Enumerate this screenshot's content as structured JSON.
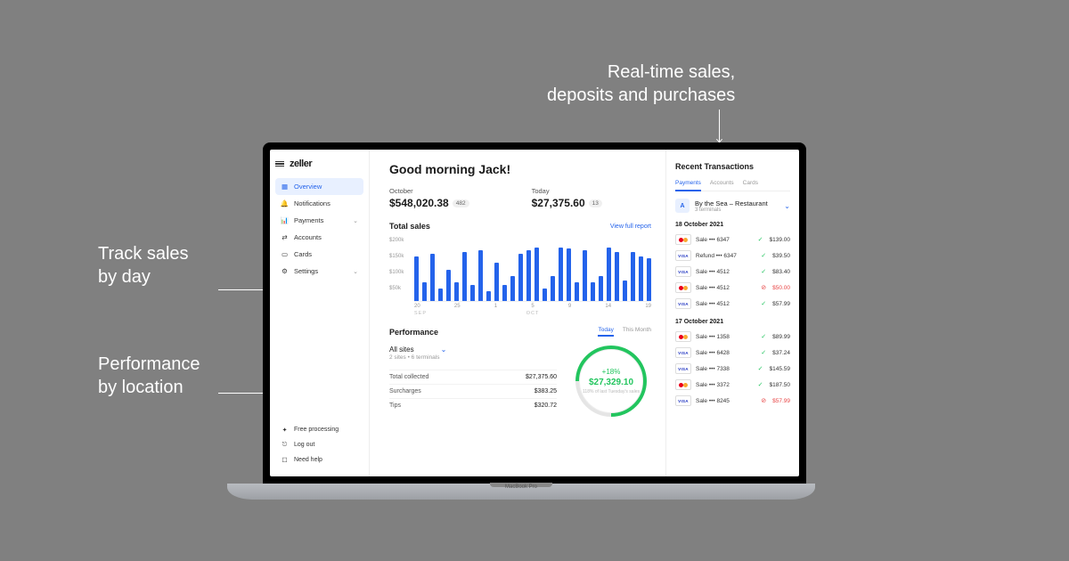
{
  "annotations": {
    "top": "Real-time sales,\ndeposits and purchases",
    "mid_line1": "Track sales",
    "mid_line2": "by day",
    "bot_line1": "Performance",
    "bot_line2": "by location"
  },
  "brand": "zeller",
  "sidebar": {
    "items": [
      {
        "label": "Overview",
        "icon": "grid",
        "active": true
      },
      {
        "label": "Notifications",
        "icon": "bell"
      },
      {
        "label": "Payments",
        "icon": "bars",
        "expandable": true
      },
      {
        "label": "Accounts",
        "icon": "swap"
      },
      {
        "label": "Cards",
        "icon": "card"
      },
      {
        "label": "Settings",
        "icon": "gear",
        "expandable": true
      }
    ],
    "footer": [
      {
        "label": "Free processing",
        "icon": "gift"
      },
      {
        "label": "Log out",
        "icon": "logout"
      },
      {
        "label": "Need help",
        "icon": "help"
      }
    ]
  },
  "main": {
    "greeting": "Good morning Jack!",
    "stats": [
      {
        "label": "October",
        "value": "$548,020.38",
        "badge": "482"
      },
      {
        "label": "Today",
        "value": "$27,375.60",
        "badge": "13"
      }
    ],
    "total_sales": {
      "title": "Total sales",
      "link": "View full report",
      "y_ticks": [
        "$200k",
        "$150k",
        "$100k",
        "$50k",
        ""
      ],
      "x_ticks": [
        "20",
        "25",
        "1",
        "5",
        "9",
        "14",
        "19"
      ],
      "x_left_label": "SEP",
      "x_mid_label": "OCT"
    },
    "performance": {
      "title": "Performance",
      "tabs": [
        "Today",
        "This Month"
      ],
      "active_tab": 0,
      "site": "All sites",
      "site_sub": "2 sites  •  6 terminals",
      "metrics": [
        {
          "label": "Total collected",
          "value": "$27,375.60"
        },
        {
          "label": "Surcharges",
          "value": "$383.25"
        },
        {
          "label": "Tips",
          "value": "$320.72"
        }
      ],
      "gauge": {
        "pct": "+18%",
        "amount": "$27,329.10",
        "sub": "118% of last Tuesday's sales"
      }
    }
  },
  "right": {
    "title": "Recent Transactions",
    "tabs": [
      "Payments",
      "Accounts",
      "Cards"
    ],
    "account": {
      "initial": "A",
      "name": "By the Sea – Restaurant",
      "sub": "3 terminals"
    },
    "groups": [
      {
        "date": "18 October 2021",
        "txns": [
          {
            "card": "mc",
            "desc": "Sale ••• 6347",
            "amount": "$139.00",
            "status": "ok"
          },
          {
            "card": "visa",
            "desc": "Refund ••• 6347",
            "amount": "$39.50",
            "status": "ok"
          },
          {
            "card": "visa",
            "desc": "Sale ••• 4512",
            "amount": "$83.40",
            "status": "ok"
          },
          {
            "card": "mc",
            "desc": "Sale ••• 4512",
            "amount": "$50.00",
            "status": "err"
          },
          {
            "card": "visa",
            "desc": "Sale ••• 4512",
            "amount": "$57.99",
            "status": "ok"
          }
        ]
      },
      {
        "date": "17 October 2021",
        "txns": [
          {
            "card": "mc",
            "desc": "Sale ••• 1358",
            "amount": "$89.99",
            "status": "ok"
          },
          {
            "card": "visa",
            "desc": "Sale ••• 6428",
            "amount": "$37.24",
            "status": "ok"
          },
          {
            "card": "visa",
            "desc": "Sale ••• 7338",
            "amount": "$145.59",
            "status": "ok"
          },
          {
            "card": "mc",
            "desc": "Sale ••• 3372",
            "amount": "$187.50",
            "status": "ok"
          },
          {
            "card": "visa",
            "desc": "Sale ••• 8245",
            "amount": "$57.99",
            "status": "err"
          }
        ]
      }
    ]
  },
  "chart_data": {
    "type": "bar",
    "title": "Total sales",
    "ylabel": "",
    "ylim": [
      0,
      200
    ],
    "y_unit": "$k",
    "x_labels_shown": [
      "20",
      "25",
      "1",
      "5",
      "9",
      "14",
      "19"
    ],
    "month_span": [
      "SEP",
      "OCT"
    ],
    "values": [
      140,
      60,
      150,
      40,
      100,
      60,
      155,
      50,
      160,
      30,
      120,
      50,
      80,
      150,
      160,
      170,
      40,
      80,
      170,
      165,
      60,
      160,
      60,
      80,
      170,
      155,
      65,
      155,
      140,
      135
    ]
  }
}
